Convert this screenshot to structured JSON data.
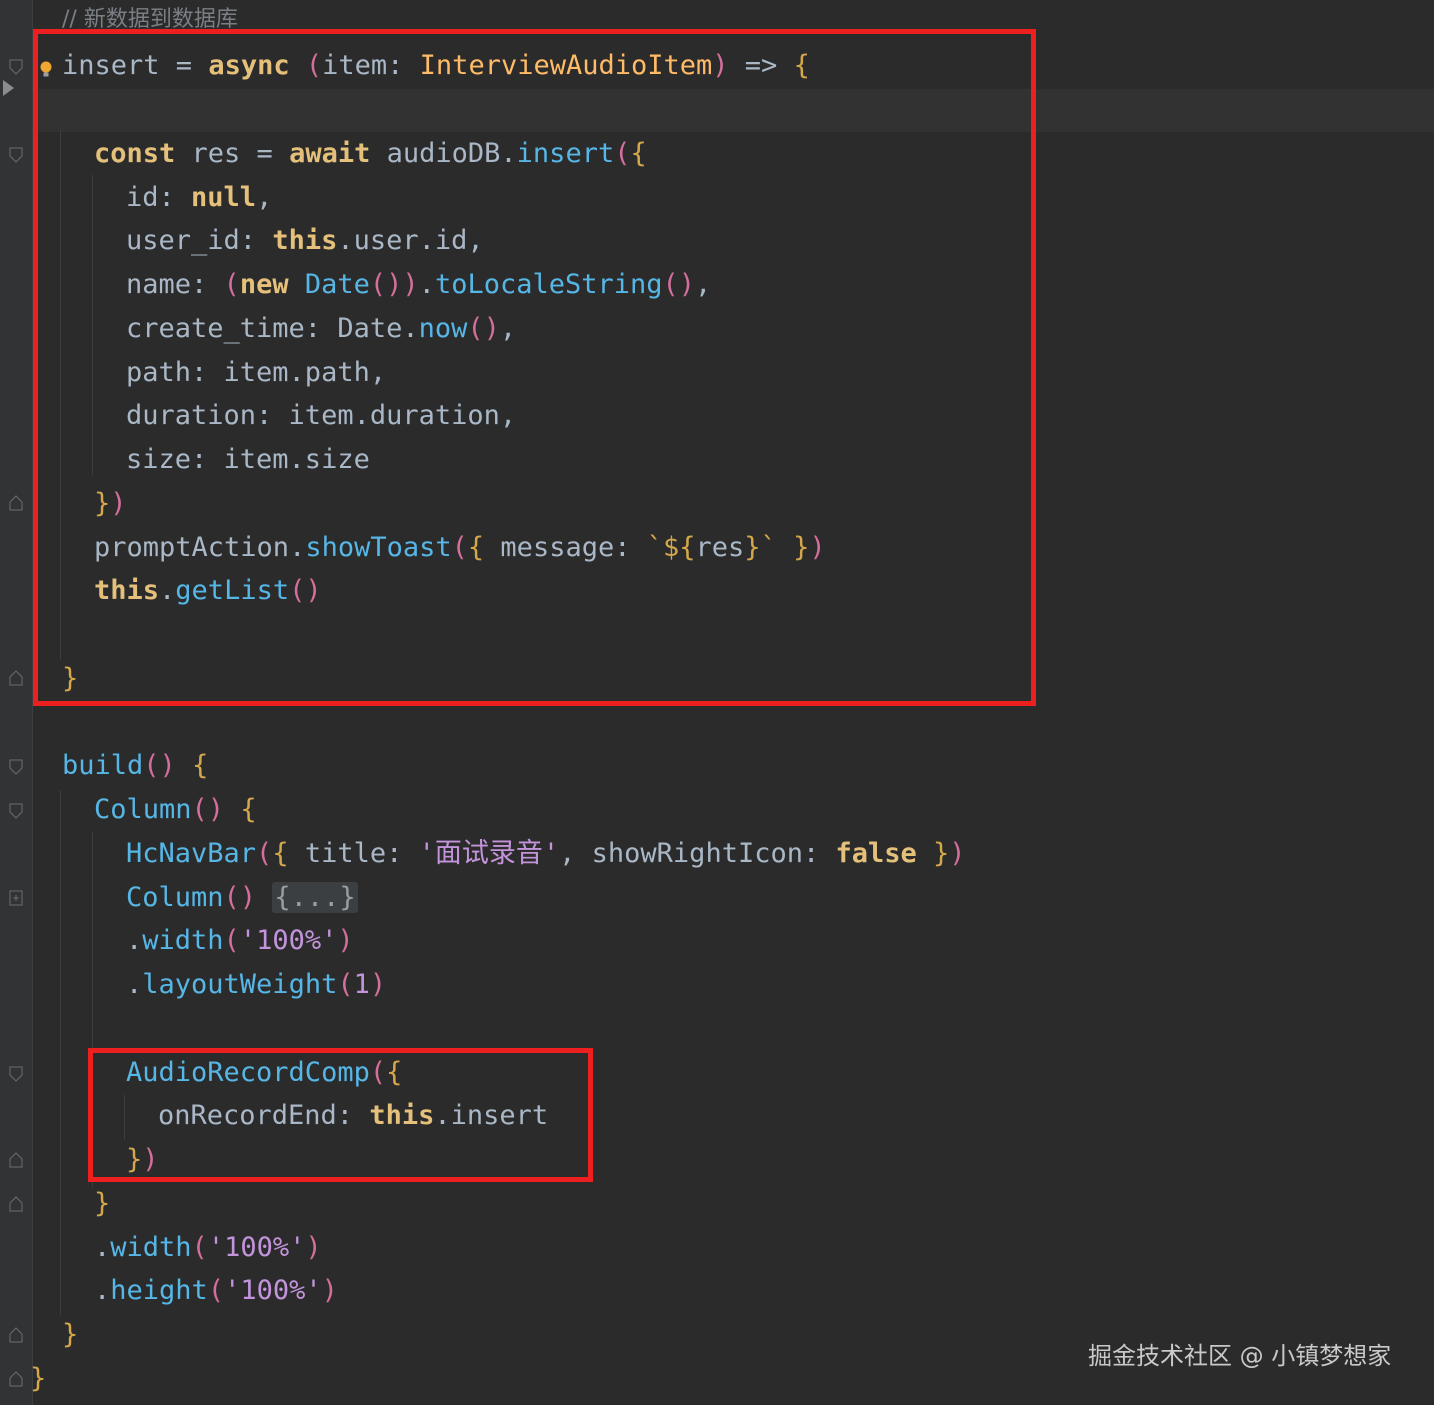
{
  "editor": {
    "comment": "// 新数据到数据库",
    "code": [
      [
        {
          "t": "insert = "
        },
        {
          "c": "k",
          "t": "async"
        },
        {
          "t": " "
        },
        {
          "c": "pr",
          "t": "("
        },
        {
          "t": "item: "
        },
        {
          "c": "t",
          "t": "InterviewAudioItem"
        },
        {
          "c": "pr",
          "t": ")"
        },
        {
          "t": " => "
        },
        {
          "c": "br",
          "t": "{"
        }
      ],
      [
        {
          "c": "k",
          "t": "const"
        },
        {
          "t": " res = "
        },
        {
          "c": "k",
          "t": "await"
        },
        {
          "t": " audioDB."
        },
        {
          "c": "f",
          "t": "insert"
        },
        {
          "c": "pr",
          "t": "("
        },
        {
          "c": "br",
          "t": "{"
        }
      ],
      [
        {
          "t": "id: "
        },
        {
          "c": "k",
          "t": "null"
        },
        {
          "t": ","
        }
      ],
      [
        {
          "t": "user_id: "
        },
        {
          "c": "k",
          "t": "this"
        },
        {
          "t": ".user.id,"
        }
      ],
      [
        {
          "t": "name: "
        },
        {
          "c": "pr",
          "t": "("
        },
        {
          "c": "k",
          "t": "new"
        },
        {
          "t": " "
        },
        {
          "c": "f",
          "t": "Date"
        },
        {
          "c": "pr",
          "t": "())"
        },
        {
          "t": "."
        },
        {
          "c": "f",
          "t": "toLocaleString"
        },
        {
          "c": "pr",
          "t": "()"
        },
        {
          "t": ","
        }
      ],
      [
        {
          "t": "create_time: Date."
        },
        {
          "c": "f",
          "t": "now"
        },
        {
          "c": "pr",
          "t": "()"
        },
        {
          "t": ","
        }
      ],
      [
        {
          "t": "path: item.path,"
        }
      ],
      [
        {
          "t": "duration: item.duration,"
        }
      ],
      [
        {
          "t": "size: item.size"
        }
      ],
      [
        {
          "c": "br",
          "t": "}"
        },
        {
          "c": "pr",
          "t": ")"
        }
      ],
      [
        {
          "t": "promptAction."
        },
        {
          "c": "f",
          "t": "showToast"
        },
        {
          "c": "pr",
          "t": "("
        },
        {
          "c": "br",
          "t": "{"
        },
        {
          "t": " message: "
        },
        {
          "c": "br",
          "t": "`${"
        },
        {
          "t": "res"
        },
        {
          "c": "br",
          "t": "}`"
        },
        {
          "t": " "
        },
        {
          "c": "br",
          "t": "}"
        },
        {
          "c": "pr",
          "t": ")"
        }
      ],
      [
        {
          "c": "k",
          "t": "this"
        },
        {
          "t": "."
        },
        {
          "c": "f",
          "t": "getList"
        },
        {
          "c": "pr",
          "t": "()"
        }
      ],
      [
        {
          "c": "br",
          "t": "}"
        }
      ],
      [
        {
          "c": "f",
          "t": "build"
        },
        {
          "c": "pr",
          "t": "()"
        },
        {
          "t": " "
        },
        {
          "c": "br",
          "t": "{"
        }
      ],
      [
        {
          "c": "f",
          "t": "Column"
        },
        {
          "c": "pr",
          "t": "()"
        },
        {
          "t": " "
        },
        {
          "c": "br",
          "t": "{"
        }
      ],
      [
        {
          "c": "f",
          "t": "HcNavBar"
        },
        {
          "c": "pr",
          "t": "("
        },
        {
          "c": "br",
          "t": "{"
        },
        {
          "t": " title: "
        },
        {
          "c": "s",
          "t": "'面试录音'"
        },
        {
          "t": ", showRightIcon: "
        },
        {
          "c": "k",
          "t": "false"
        },
        {
          "t": " "
        },
        {
          "c": "br",
          "t": "}"
        },
        {
          "c": "pr",
          "t": ")"
        }
      ],
      [
        {
          "c": "f",
          "t": "Column"
        },
        {
          "c": "pr",
          "t": "()"
        },
        {
          "t": " "
        },
        {
          "c": "fold-block",
          "t": "{...}"
        }
      ],
      [
        {
          "t": "."
        },
        {
          "c": "f",
          "t": "width"
        },
        {
          "c": "pr",
          "t": "("
        },
        {
          "c": "s",
          "t": "'100%'"
        },
        {
          "c": "pr",
          "t": ")"
        }
      ],
      [
        {
          "t": "."
        },
        {
          "c": "f",
          "t": "layoutWeight"
        },
        {
          "c": "pr",
          "t": "("
        },
        {
          "c": "s",
          "t": "1"
        },
        {
          "c": "pr",
          "t": ")"
        }
      ],
      [
        {
          "c": "f",
          "t": "AudioRecordComp"
        },
        {
          "c": "pr",
          "t": "("
        },
        {
          "c": "br",
          "t": "{"
        }
      ],
      [
        {
          "t": "onRecordEnd: "
        },
        {
          "c": "k",
          "t": "this"
        },
        {
          "t": ".insert"
        }
      ],
      [
        {
          "c": "br",
          "t": "}"
        },
        {
          "c": "pr",
          "t": ")"
        }
      ],
      [
        {
          "c": "br",
          "t": "}"
        }
      ],
      [
        {
          "t": "."
        },
        {
          "c": "f",
          "t": "width"
        },
        {
          "c": "pr",
          "t": "("
        },
        {
          "c": "s",
          "t": "'100%'"
        },
        {
          "c": "pr",
          "t": ")"
        }
      ],
      [
        {
          "t": "."
        },
        {
          "c": "f",
          "t": "height"
        },
        {
          "c": "pr",
          "t": "("
        },
        {
          "c": "s",
          "t": "'100%'"
        },
        {
          "c": "pr",
          "t": ")"
        }
      ],
      [
        {
          "c": "br",
          "t": "}"
        }
      ],
      [
        {
          "c": "br",
          "t": "}"
        }
      ]
    ]
  },
  "watermark": "掘金技术社区 @ 小镇梦想家",
  "icons": [
    "bulb-icon",
    "fold-icon",
    "run-arrow-icon"
  ],
  "colors": {
    "background": "#2b2b2b",
    "keyword": "#e4c07a",
    "function": "#56b6e6",
    "string": "#c394dc",
    "highlight_box": "#ee1f1f"
  }
}
